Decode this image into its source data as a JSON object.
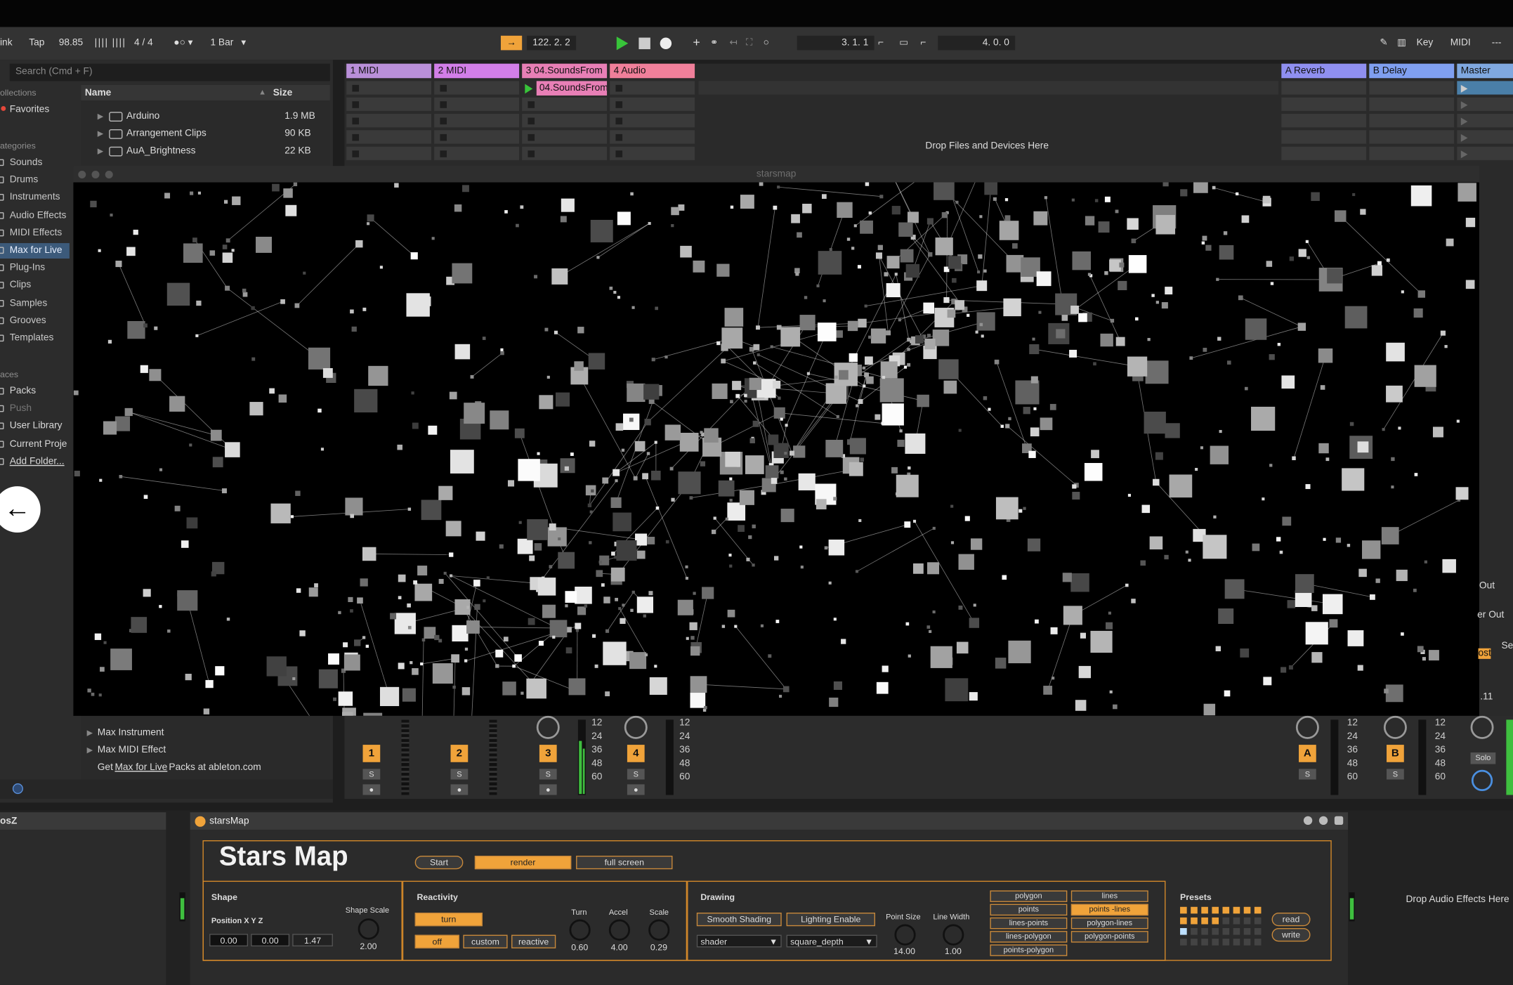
{
  "transport": {
    "link_label": "ink",
    "tap_label": "Tap",
    "tempo": "98.85",
    "time_sig": "4 / 4",
    "quantize": "1 Bar",
    "position": "122.  2.  2",
    "loop_start": "3.  1.  1",
    "loop_length": "4.  0.  0",
    "key_label": "Key",
    "midi_label": "MIDI",
    "menu_label": "---"
  },
  "browser": {
    "search_placeholder": "Search (Cmd + F)",
    "collections_hdr": "ollections",
    "favorites": "Favorites",
    "categories_hdr": "ategories",
    "categories": [
      "Sounds",
      "Drums",
      "Instruments",
      "Audio Effects",
      "MIDI Effects",
      "Max for Live",
      "Plug-Ins",
      "Clips",
      "Samples",
      "Grooves",
      "Templates"
    ],
    "places_hdr": "aces",
    "places": [
      "Packs",
      "Push",
      "User Library",
      "Current Proje",
      "Add Folder..."
    ],
    "col_name": "Name",
    "col_size": "Size",
    "files": [
      {
        "name": "Arduino",
        "size": "1.9 MB"
      },
      {
        "name": "Arrangement Clips",
        "size": "90 KB"
      },
      {
        "name": "AuA_Brightness",
        "size": "22 KB"
      }
    ],
    "lower_items": [
      "Max Instrument",
      "Max MIDI Effect"
    ],
    "get_text_prefix": "Get ",
    "get_text_link": "Max for Live",
    "get_text_suffix": " Packs at ableton.com"
  },
  "session": {
    "tracks": [
      {
        "name": "1 MIDI",
        "color": "#b98fd9"
      },
      {
        "name": "2 MIDI",
        "color": "#d27ee8"
      },
      {
        "name": "3 04.SoundsFrom",
        "color": "#e87fb6"
      },
      {
        "name": "4 Audio",
        "color": "#f07f9a"
      }
    ],
    "returns": [
      {
        "name": "A Reverb",
        "color": "#8f8ff0"
      },
      {
        "name": "B Delay",
        "color": "#7f9ff0"
      },
      {
        "name": "Master",
        "color": "#7fa8e0"
      }
    ],
    "playing_clip": "04.SoundsFrom",
    "drop_text": "Drop Files and Devices Here"
  },
  "viewer": {
    "title": "starsmap"
  },
  "mixer": {
    "track_numbers": [
      "1",
      "2",
      "3",
      "4"
    ],
    "return_letters": [
      "A",
      "B"
    ],
    "solo_label": "S",
    "master_solo": "Solo",
    "db_labels": [
      "12",
      "24",
      "36",
      "48",
      "60"
    ],
    "right_labels": [
      "Out",
      "er Out",
      "Se",
      "ost",
      ".11"
    ]
  },
  "device": {
    "left_panel_label": "osZ",
    "header_title": "starsMap",
    "title": "Stars Map",
    "start_label": "Start",
    "render_label": "render",
    "fullscreen_label": "full screen",
    "shape": {
      "label": "Shape",
      "position_label": "Position X Y Z",
      "x": "0.00",
      "y": "0.00",
      "z": "1.47",
      "scale_label": "Shape Scale",
      "scale_value": "2.00"
    },
    "reactivity": {
      "label": "Reactivity",
      "turn_btn": "turn",
      "off_btn": "off",
      "custom_btn": "custom",
      "reactive_btn": "reactive",
      "turn_label": "Turn",
      "turn_value": "0.60",
      "accel_label": "Accel",
      "accel_value": "4.00",
      "scale_label": "Scale",
      "scale_value": "0.29"
    },
    "drawing": {
      "label": "Drawing",
      "smooth_btn": "Smooth Shading",
      "lighting_btn": "Lighting Enable",
      "shader_menu": "shader",
      "depth_menu": "square_depth",
      "point_size_label": "Point Size",
      "point_size_value": "14.00",
      "line_width_label": "Line Width",
      "line_width_value": "1.00",
      "modes": [
        "polygon",
        "lines",
        "points",
        "points -lines",
        "lines-points",
        "polygon-lines",
        "lines-polygon",
        "polygon-points",
        "points-polygon"
      ],
      "active_mode": "points -lines"
    },
    "presets": {
      "label": "Presets",
      "read_btn": "read",
      "write_btn": "write"
    },
    "drop_audio_text": "Drop Audio Effects Here"
  },
  "colors": {
    "accent": "#f0a33a",
    "play": "#38c43a",
    "selected": "#3c5a7a"
  }
}
